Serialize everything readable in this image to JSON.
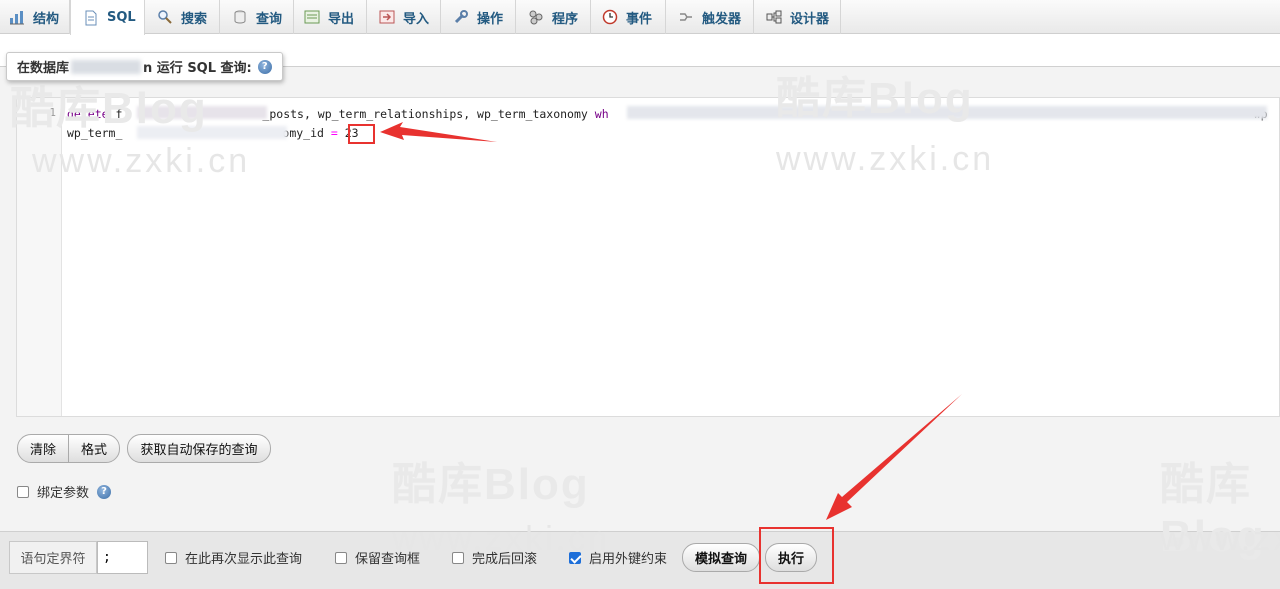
{
  "tabs": [
    {
      "label": "结构",
      "icon": "structure-icon"
    },
    {
      "label": "SQL",
      "icon": "sql-icon",
      "active": true
    },
    {
      "label": "搜索",
      "icon": "search-icon"
    },
    {
      "label": "查询",
      "icon": "query-icon"
    },
    {
      "label": "导出",
      "icon": "export-icon"
    },
    {
      "label": "导入",
      "icon": "import-icon"
    },
    {
      "label": "操作",
      "icon": "wrench-icon"
    },
    {
      "label": "程序",
      "icon": "routines-icon"
    },
    {
      "label": "事件",
      "icon": "clock-icon"
    },
    {
      "label": "触发器",
      "icon": "trigger-icon"
    },
    {
      "label": "设计器",
      "icon": "designer-icon"
    }
  ],
  "query_title": {
    "prefix": "在数据库",
    "suffix": "n 运行 SQL 查询:"
  },
  "editor": {
    "line_number": "1",
    "line1_kw": "delete",
    "line1_a": "f",
    "line1_b": "_posts, wp_term_relationships, wp_term_taxonomy",
    "line1_kw2": "wh",
    "line1_c": "wp",
    "line2_a": "wp_term_",
    "line2_b": "omy_id",
    "line2_op": "=",
    "line2_val": "23"
  },
  "buttons": {
    "clear": "清除",
    "format": "格式",
    "get_autosaved": "获取自动保存的查询",
    "simulate": "模拟查询",
    "execute": "执行"
  },
  "bind_params": {
    "label": "绑定参数",
    "checked": false
  },
  "bottom": {
    "delimiter_label": "语句定界符",
    "delimiter_value": ";",
    "show_again": {
      "label": "在此再次显示此查询",
      "checked": false
    },
    "retain_box": {
      "label": "保留查询框",
      "checked": false
    },
    "rollback": {
      "label": "完成后回滚",
      "checked": false
    },
    "fk_checks": {
      "label": "启用外键约束",
      "checked": true
    }
  },
  "watermark": {
    "brand": "酷库Blog",
    "url": "www.zxki.cn"
  },
  "colors": {
    "tab_text": "#235a81",
    "annotation_red": "#e8322f",
    "checkbox_blue": "#1e6fd9"
  }
}
